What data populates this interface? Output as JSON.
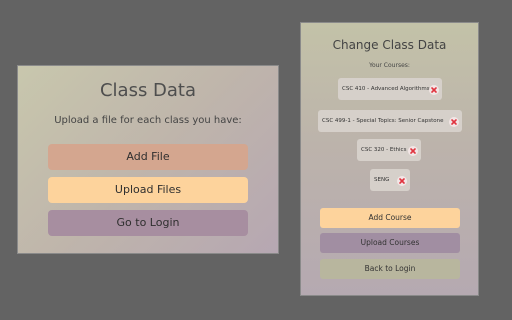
{
  "class_data_card": {
    "title": "Class Data",
    "subtitle": "Upload a file for each class you have:",
    "buttons": {
      "add_file": "Add File",
      "upload_files": "Upload Files",
      "go_to_login": "Go to Login"
    }
  },
  "change_class_card": {
    "title": "Change Class Data",
    "subtitle": "Your Courses:",
    "courses": [
      {
        "label": "CSC 410 - Advanced Algorithms",
        "delete_icon": "close-icon"
      },
      {
        "label": "CSC 499-1 - Special Topics: Senior Capstone",
        "delete_icon": "close-icon"
      },
      {
        "label": "CSC 320 - Ethics",
        "delete_icon": "close-icon"
      },
      {
        "label": "SENG",
        "delete_icon": "close-icon"
      }
    ],
    "buttons": {
      "add_course": "Add Course",
      "upload_courses": "Upload Courses",
      "back_to_login": "Back to Login"
    }
  },
  "colors": {
    "background": "#636363",
    "orange_button": "#fdd39c",
    "salmon_button": "#d4a68f",
    "mauve_button": "#a78ea0",
    "olive_button": "#b8b69e",
    "delete_icon": "#e0343f"
  }
}
